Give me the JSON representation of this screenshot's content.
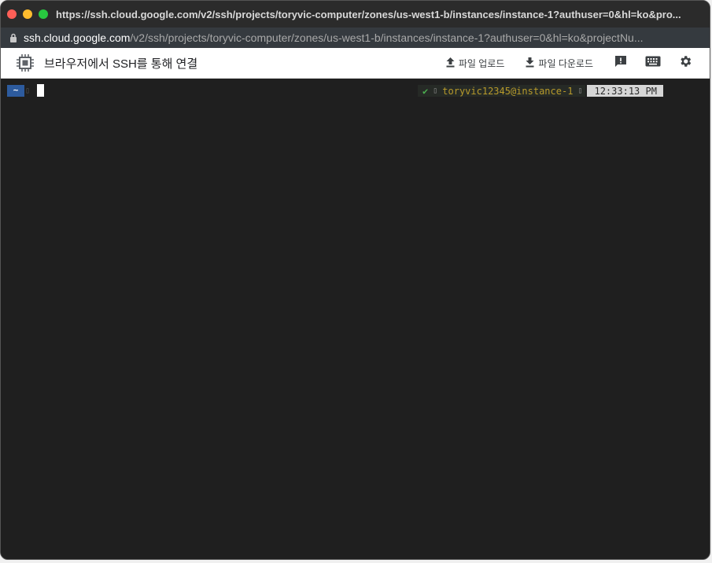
{
  "window": {
    "title": "https://ssh.cloud.google.com/v2/ssh/projects/toryvic-computer/zones/us-west1-b/instances/instance-1?authuser=0&hl=ko&pro..."
  },
  "address_bar": {
    "host": "ssh.cloud.google.com",
    "path": "/v2/ssh/projects/toryvic-computer/zones/us-west1-b/instances/instance-1?authuser=0&hl=ko&projectNu..."
  },
  "app_bar": {
    "title": "브라우저에서 SSH를 통해 연결",
    "upload_label": "파일 업로드",
    "download_label": "파일 다운로드",
    "icons": [
      "chip-icon",
      "upload-icon",
      "download-icon",
      "feedback-icon",
      "keyboard-icon",
      "settings-icon"
    ]
  },
  "terminal": {
    "prompt_dir": "~",
    "status_check": "✔",
    "user_host": "toryvic12345@instance-1",
    "time": "12:33:13 PM"
  },
  "colors": {
    "terminal_bg": "#1f1f1f",
    "prompt_blue": "#2d5b9e",
    "user_host_text": "#b89a2b",
    "time_bg": "#d6d6d6"
  }
}
